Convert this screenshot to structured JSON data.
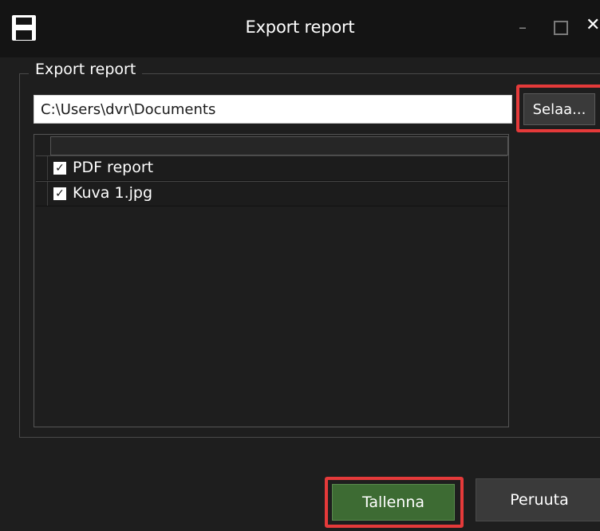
{
  "window": {
    "title": "Export report",
    "minimize_icon": "minimize-icon",
    "maximize_icon": "maximize-icon",
    "close_icon": "close-icon",
    "app_icon": "save-disk-icon"
  },
  "export_group": {
    "label": "Export report",
    "path_value": "C:\\Users\\dvr\\Documents",
    "browse_label": "Selaa...",
    "items": [
      {
        "label": "PDF report",
        "checked": true
      },
      {
        "label": "Kuva 1.jpg",
        "checked": true
      }
    ]
  },
  "footer": {
    "save_label": "Tallenna",
    "cancel_label": "Peruuta"
  },
  "colors": {
    "highlight": "#e53a3a",
    "save_button": "#3d6b33",
    "background": "#1e1e1e"
  }
}
